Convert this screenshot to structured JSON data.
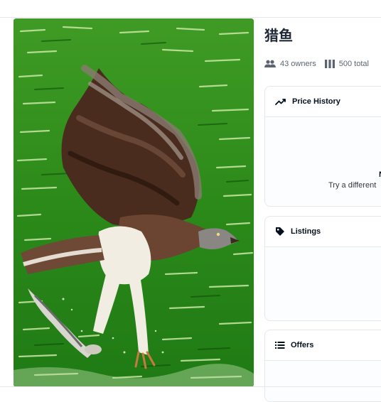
{
  "item": {
    "title": "猎鱼",
    "owners_label": "43 owners",
    "total_label": "500 total"
  },
  "price_history": {
    "header": "Price History",
    "empty_title": "N",
    "empty_subtitle": "Try a different"
  },
  "listings": {
    "header": "Listings"
  },
  "offers": {
    "header": "Offers"
  },
  "icons": {
    "owners": "people-icon",
    "total": "grid-columns-icon",
    "price_history": "trending-up-icon",
    "listings": "tag-icon",
    "offers": "list-icon"
  },
  "colors": {
    "text": "#04111d",
    "muted": "#5b6470",
    "border": "#e5e8eb",
    "water": "#2f8a1c"
  }
}
